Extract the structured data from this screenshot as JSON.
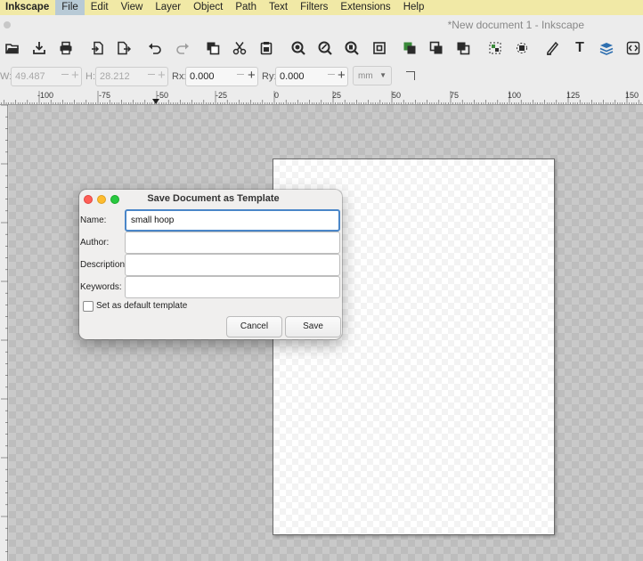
{
  "menubar": {
    "app": "Inkscape",
    "items": [
      "File",
      "Edit",
      "View",
      "Layer",
      "Object",
      "Path",
      "Text",
      "Filters",
      "Extensions",
      "Help"
    ]
  },
  "window": {
    "title": "*New document 1 - Inkscape"
  },
  "toolbar": {
    "w_label": "W:",
    "w_value": "49.487",
    "h_label": "H:",
    "h_value": "28.212",
    "rx_label": "Rx:",
    "rx_value": "0.000",
    "ry_label": "Ry:",
    "ry_value": "0.000",
    "unit": "mm"
  },
  "ruler": {
    "labels": [
      "-100",
      "-75",
      "-50",
      "-25",
      "0",
      "25",
      "50",
      "75",
      "100",
      "125",
      "150"
    ]
  },
  "dialog": {
    "title": "Save Document as Template",
    "name_label": "Name:",
    "name_value": "small hoop",
    "author_label": "Author:",
    "author_value": "",
    "description_label": "Description:",
    "description_value": "",
    "keywords_label": "Keywords:",
    "keywords_value": "",
    "default_template_label": "Set as default template",
    "default_template_checked": false,
    "cancel_label": "Cancel",
    "save_label": "Save"
  },
  "colors": {
    "menubar_bg": "#f1e9a6",
    "active_menu_bg": "#b8cad6",
    "focus_ring": "#4a86c8",
    "close": "#fe5f57",
    "minimize": "#febc2e",
    "maximize": "#28c840"
  },
  "icons": [
    "open-icon",
    "save-icon",
    "print-icon",
    "import-icon",
    "export-icon",
    "undo-icon",
    "redo-icon",
    "copy-icon",
    "cut-icon",
    "paste-icon",
    "zoom-selection-icon",
    "zoom-drawing-icon",
    "zoom-page-icon",
    "zoom-fit-icon",
    "duplicate-icon",
    "clone-icon",
    "unlink-clone-icon",
    "group-icon",
    "ungroup-icon",
    "fill-stroke-icon",
    "text-font-icon",
    "layers-icon",
    "xml-editor-icon"
  ]
}
